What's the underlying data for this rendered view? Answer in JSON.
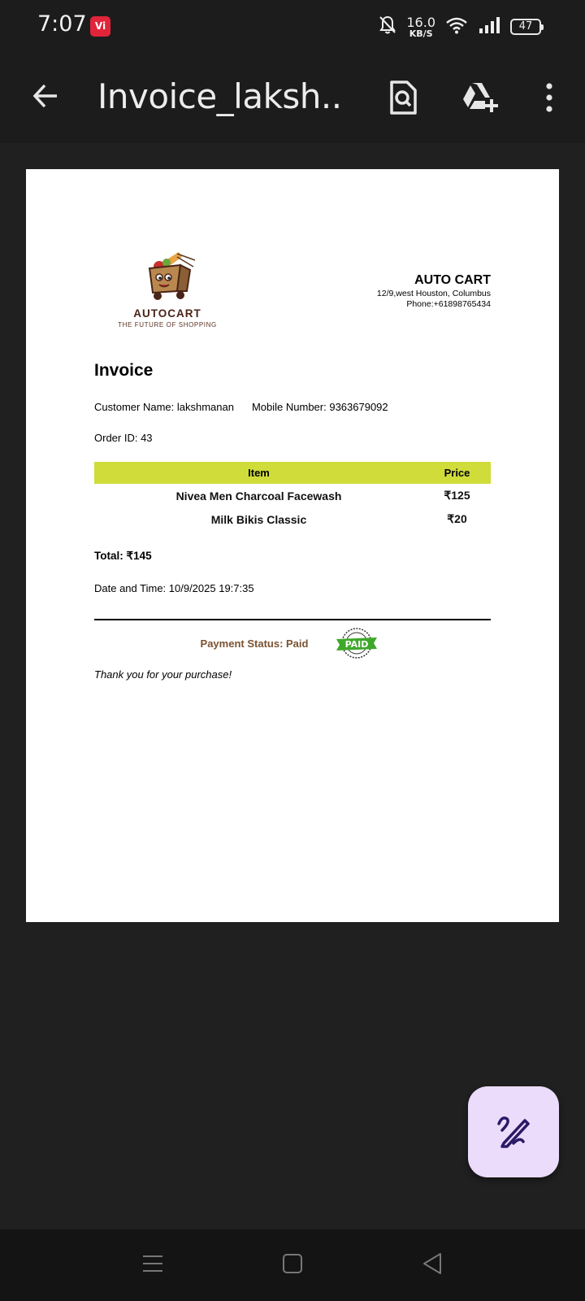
{
  "status_bar": {
    "time": "7:07",
    "carrier_badge": "Vi",
    "network_speed_value": "16.0",
    "network_speed_unit": "KB/S",
    "battery_level": "47",
    "icons": [
      "vi-carrier-icon",
      "bell-muted-icon",
      "wifi-icon",
      "signal-icon",
      "battery-icon"
    ]
  },
  "app_bar": {
    "title": "Invoice_laksh...",
    "icons": [
      "back-arrow-icon",
      "document-search-icon",
      "drive-add-icon",
      "more-vert-icon"
    ]
  },
  "invoice": {
    "logo": {
      "brand": "AUTOCART",
      "tagline": "THE FUTURE OF SHOPPING"
    },
    "company": {
      "name": "AUTO CART",
      "address": "12/9,west Houston, Columbus",
      "phone": "Phone:+61898765434"
    },
    "title": "Invoice",
    "customer_name": "Customer Name: lakshmanan",
    "mobile_number": "Mobile Number: 9363679092",
    "order_id": "Order ID: 43",
    "table": {
      "headers": [
        "Item",
        "Price"
      ],
      "rows": [
        {
          "item": "Nivea Men Charcoal Facewash",
          "price": "₹125"
        },
        {
          "item": "Milk Bikis Classic",
          "price": "₹20"
        }
      ]
    },
    "total": "Total: ₹145",
    "date_time": "Date and Time: 10/9/2025 19:7:35",
    "payment_status": "Payment Status: Paid",
    "stamp_text": "PAID",
    "thanks": "Thank you for your purchase!"
  },
  "colors": {
    "table_header": "#cfdc3a",
    "payment_status": "#7a5232",
    "fab_background": "#ebdcfb",
    "fab_icon": "#2b1a66",
    "stamp_green": "#3ea82a"
  },
  "fab": {
    "icon": "annotate-pen-icon"
  },
  "nav_bar": {
    "icons": [
      "recents-menu-icon",
      "home-square-icon",
      "back-triangle-icon"
    ]
  }
}
